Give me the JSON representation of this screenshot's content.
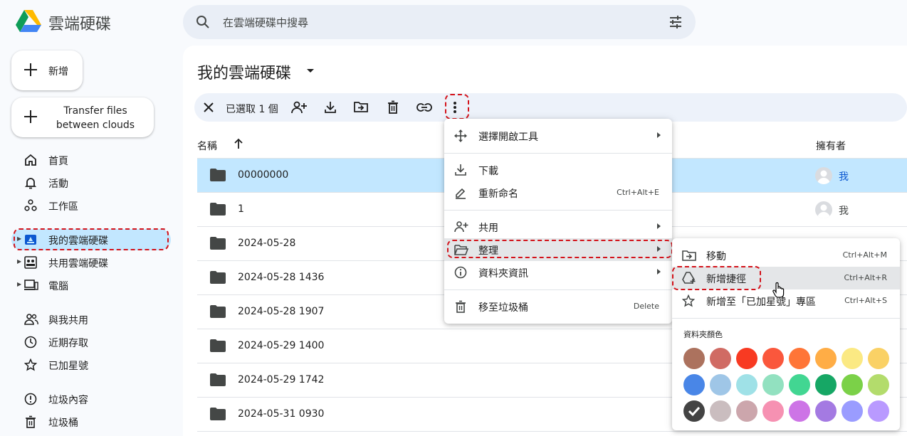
{
  "app": {
    "title": "雲端硬碟"
  },
  "search": {
    "placeholder": "在雲端硬碟中搜尋"
  },
  "sidebar": {
    "new_label": "新增",
    "transfer_label": "Transfer files between clouds",
    "items": [
      {
        "label": "首頁",
        "icon": "home-icon"
      },
      {
        "label": "活動",
        "icon": "bell-icon"
      },
      {
        "label": "工作區",
        "icon": "workspaces-icon"
      },
      {
        "label": "我的雲端硬碟",
        "icon": "my-drive-icon",
        "active": true
      },
      {
        "label": "共用雲端硬碟",
        "icon": "shared-drives-icon"
      },
      {
        "label": "電腦",
        "icon": "computers-icon"
      },
      {
        "label": "與我共用",
        "icon": "shared-with-me-icon"
      },
      {
        "label": "近期存取",
        "icon": "clock-icon"
      },
      {
        "label": "已加星號",
        "icon": "star-icon"
      },
      {
        "label": "垃圾內容",
        "icon": "spam-icon"
      },
      {
        "label": "垃圾桶",
        "icon": "trash-icon"
      }
    ]
  },
  "main": {
    "title": "我的雲端硬碟",
    "selection_text": "已選取 1 個",
    "columns": {
      "name": "名稱",
      "owner": "擁有者"
    },
    "rows": [
      {
        "name": "00000000",
        "owner": "我",
        "selected": true
      },
      {
        "name": "1",
        "owner": "我"
      },
      {
        "name": "2024-05-28",
        "owner": ""
      },
      {
        "name": "2024-05-28 1436",
        "owner": ""
      },
      {
        "name": "2024-05-28 1907",
        "owner": ""
      },
      {
        "name": "2024-05-29 1400",
        "owner": ""
      },
      {
        "name": "2024-05-29 1742",
        "owner": ""
      },
      {
        "name": "2024-05-31 0930",
        "owner": ""
      }
    ]
  },
  "context_menu": {
    "items": [
      {
        "label": "選擇開啟工具",
        "shortcut": "",
        "submenu": true
      },
      {
        "label": "下載",
        "shortcut": ""
      },
      {
        "label": "重新命名",
        "shortcut": "Ctrl+Alt+E"
      },
      {
        "label": "共用",
        "shortcut": "",
        "submenu": true
      },
      {
        "label": "整理",
        "shortcut": "",
        "submenu": true,
        "highlighted": true
      },
      {
        "label": "資料夾資訊",
        "shortcut": "",
        "submenu": true
      },
      {
        "label": "移至垃圾桶",
        "shortcut": "Delete"
      }
    ]
  },
  "organize_menu": {
    "items": [
      {
        "label": "移動",
        "shortcut": "Ctrl+Alt+M"
      },
      {
        "label": "新增捷徑",
        "shortcut": "Ctrl+Alt+R",
        "highlighted": true
      },
      {
        "label": "新增至「已加星號」專區",
        "shortcut": "Ctrl+Alt+S"
      }
    ],
    "color_title": "資料夾顏色",
    "colors": [
      "#ac725e",
      "#d06b64",
      "#f83a22",
      "#fa573c",
      "#ff7537",
      "#ffad46",
      "#fbe983",
      "#fad165",
      "#4986e7",
      "#9fc6e7",
      "#9fe1e7",
      "#92e1c0",
      "#42d692",
      "#16a765",
      "#7bd148",
      "#b3dc6c",
      "#434343",
      "#cabdbf",
      "#cca6ac",
      "#f691b2",
      "#cd74e6",
      "#a47ae2",
      "#9a9cff",
      "#b99aff"
    ],
    "selected_color": "#434343"
  }
}
